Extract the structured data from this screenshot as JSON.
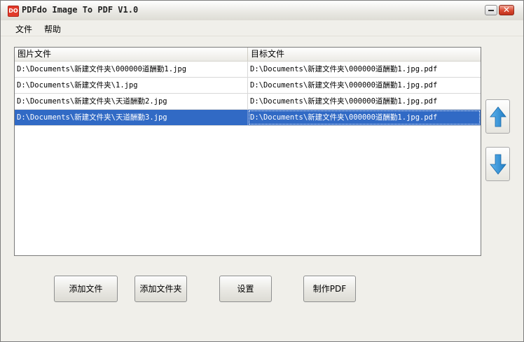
{
  "window": {
    "title": "PDFdo Image To PDF V1.0",
    "logo_text": "DO"
  },
  "menu": [
    {
      "label": "文件"
    },
    {
      "label": "帮助"
    }
  ],
  "list": {
    "columns": [
      "图片文件",
      "目标文件"
    ],
    "rows": [
      {
        "source": "D:\\Documents\\新建文件夹\\000000道酬勤1.jpg",
        "target": "D:\\Documents\\新建文件夹\\000000道酬勤1.jpg.pdf",
        "selected": false
      },
      {
        "source": "D:\\Documents\\新建文件夹\\1.jpg",
        "target": "D:\\Documents\\新建文件夹\\000000道酬勤1.jpg.pdf",
        "selected": false
      },
      {
        "source": "D:\\Documents\\新建文件夹\\天道酬勤2.jpg",
        "target": "D:\\Documents\\新建文件夹\\000000道酬勤1.jpg.pdf",
        "selected": false
      },
      {
        "source": "D:\\Documents\\新建文件夹\\天道酬勤3.jpg",
        "target": "D:\\Documents\\新建文件夹\\000000道酬勤1.jpg.pdf",
        "selected": true
      }
    ]
  },
  "buttons": {
    "add_file": "添加文件",
    "add_folder": "添加文件夹",
    "settings": "设置",
    "make_pdf": "制作PDF"
  },
  "icons": {
    "move_up": "arrow-up-icon",
    "move_down": "arrow-down-icon",
    "minimize": "minimize-icon",
    "close": "close-icon"
  },
  "colors": {
    "selection": "#316ac5",
    "arrow": "#2f8fd6",
    "close_button": "#d94a31"
  }
}
